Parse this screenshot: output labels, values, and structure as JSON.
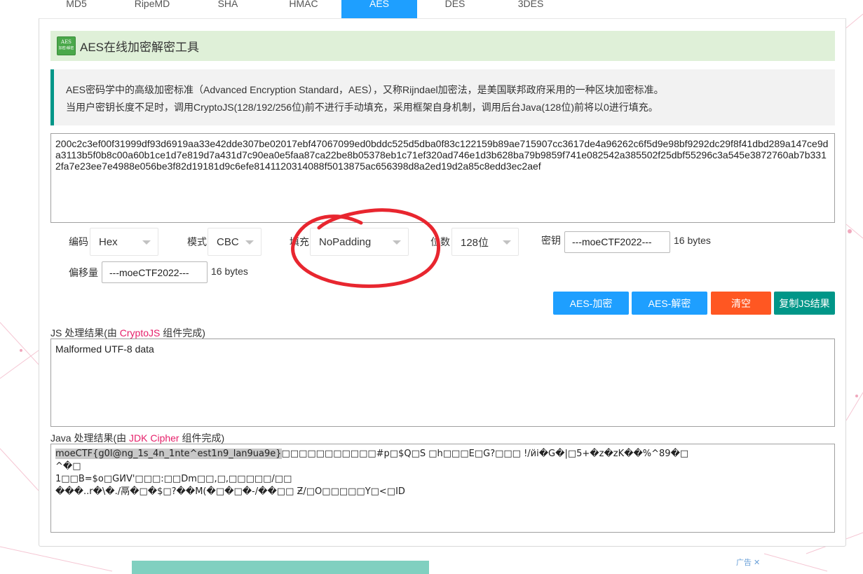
{
  "tabs": [
    "MD5",
    "RipeMD",
    "SHA",
    "HMAC",
    "AES",
    "DES",
    "3DES"
  ],
  "active_tab": "AES",
  "title": {
    "logo_line1": "AES",
    "logo_line2": "加密/解密",
    "text": "AES在线加密解密工具"
  },
  "info": {
    "line1": "AES密码学中的高级加密标准（Advanced Encryption Standard，AES），又称Rijndael加密法，是美国联邦政府采用的一种区块加密标准。",
    "line2": "当用户密钥长度不足时，调用CryptoJS(128/192/256位)前不进行手动填充，采用框架自身机制，调用后台Java(128位)前将以0进行填充。"
  },
  "input_text": "200c2c3ef00f31999df93d6919aa33e42dde307be02017ebf47067099ed0bddc525d5dba0f83c122159b89ae715907cc3617de4a96262c6f5d9e98bf9292dc29f8f41dbd289a147ce9da3113b5f0b8c00a60b1ce1d7e819d7a431d7c90ea0e5faa87ca22be8b05378eb1c71ef320ad746e1d3b628ba79b9859f741e082542a385502f25dbf55296c3a545e3872760ab7b3312fa7e23ee7e4988e056be3f82d19181d9c6efe8141120314088f5013875ac656398d8a2ed19d2a85c8edd3ec2aef",
  "options": {
    "encoding_label": "编码",
    "encoding_value": "Hex",
    "mode_label": "模式",
    "mode_value": "CBC",
    "padding_label": "填充",
    "padding_value": "NoPadding",
    "bits_label": "位数",
    "bits_value": "128位",
    "key_label": "密钥",
    "key_value": "---moeCTF2022---",
    "key_bytes": "16 bytes",
    "iv_label": "偏移量",
    "iv_value": "---moeCTF2022---",
    "iv_bytes": "16 bytes"
  },
  "buttons": {
    "encrypt": "AES-加密",
    "decrypt": "AES-解密",
    "clear": "清空",
    "copy": "复制JS结果"
  },
  "js_result": {
    "label_prefix": "JS 处理结果(由 ",
    "label_link": "CryptoJS",
    "label_suffix": " 组件完成)",
    "value": "Malformed UTF-8 data"
  },
  "java_result": {
    "label_prefix": "Java 处理结果(由 ",
    "label_link": "JDK Cipher",
    "label_suffix": " 组件完成)",
    "flag": "moeCTF{g0l@ng_1s_4n_1nte^est1n9_lan9ua9e}",
    "line1_rest": "□□□□□□□□□□□#p□$Q□S □h□□□E□G?□□□     !/йі�G�|□5+�z�zK��%^89�□",
    "line2": "^�□",
    "line3": "1□□B=$o□GИV'□□□:□□Dm□□,□,□□□□□/□□",
    "line4": "���..r�\\�./鬲�□�$□?��M(�□�□�-/��□□   Ƶ/□O□□□□□Y□<□ID"
  },
  "ad": {
    "label": "广告 ✕"
  },
  "colors": {
    "tab_active": "#1e9fff",
    "title_bg": "#dff0d8",
    "accent": "#009688",
    "encrypt_btn": "#1e9fff",
    "clear_btn": "#ff5722",
    "copy_btn": "#009688",
    "annotation": "#e8262f",
    "link": "#e6206a"
  }
}
